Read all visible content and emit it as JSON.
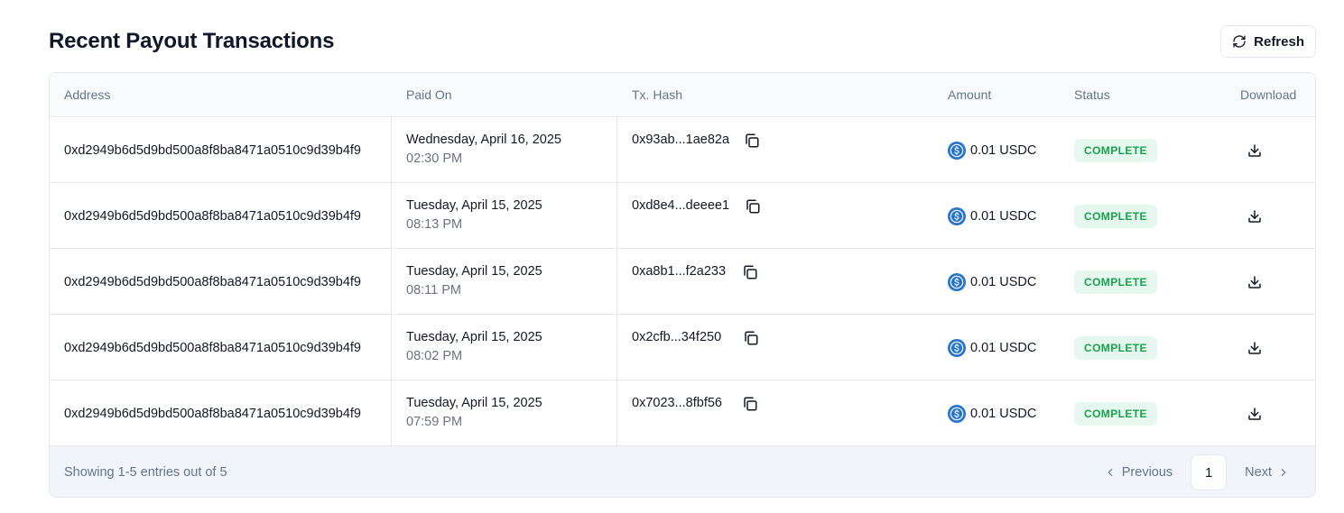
{
  "header": {
    "title": "Recent Payout Transactions",
    "refresh_label": "Refresh"
  },
  "table": {
    "columns": {
      "address": "Address",
      "paid_on": "Paid On",
      "tx_hash": "Tx. Hash",
      "amount": "Amount",
      "status": "Status",
      "download": "Download"
    },
    "rows": [
      {
        "address": "0xd2949b6d5d9bd500a8f8ba8471a0510c9d39b4f9",
        "date": "Wednesday, April 16, 2025",
        "time": "02:30 PM",
        "hash": "0x93ab...1ae82a",
        "amount": "0.01 USDC",
        "status": "COMPLETE"
      },
      {
        "address": "0xd2949b6d5d9bd500a8f8ba8471a0510c9d39b4f9",
        "date": "Tuesday, April 15, 2025",
        "time": "08:13 PM",
        "hash": "0xd8e4...deeee1",
        "amount": "0.01 USDC",
        "status": "COMPLETE"
      },
      {
        "address": "0xd2949b6d5d9bd500a8f8ba8471a0510c9d39b4f9",
        "date": "Tuesday, April 15, 2025",
        "time": "08:11 PM",
        "hash": "0xa8b1...f2a233",
        "amount": "0.01 USDC",
        "status": "COMPLETE"
      },
      {
        "address": "0xd2949b6d5d9bd500a8f8ba8471a0510c9d39b4f9",
        "date": "Tuesday, April 15, 2025",
        "time": "08:02 PM",
        "hash": "0x2cfb...34f250",
        "amount": "0.01 USDC",
        "status": "COMPLETE"
      },
      {
        "address": "0xd2949b6d5d9bd500a8f8ba8471a0510c9d39b4f9",
        "date": "Tuesday, April 15, 2025",
        "time": "07:59 PM",
        "hash": "0x7023...8fbf56",
        "amount": "0.01 USDC",
        "status": "COMPLETE"
      }
    ]
  },
  "footer": {
    "showing": "Showing 1-5 entries out of 5",
    "previous_label": "Previous",
    "page": "1",
    "next_label": "Next"
  },
  "colors": {
    "status_complete_bg": "#e6f7ef",
    "status_complete_text": "#16a34a",
    "usdc_blue": "#2775ca"
  },
  "icons": {
    "refresh": "refresh-icon",
    "copy": "copy-icon",
    "usdc": "usdc-coin-icon",
    "download": "download-icon",
    "prev": "chevron-left-icon",
    "next": "chevron-right-icon"
  }
}
